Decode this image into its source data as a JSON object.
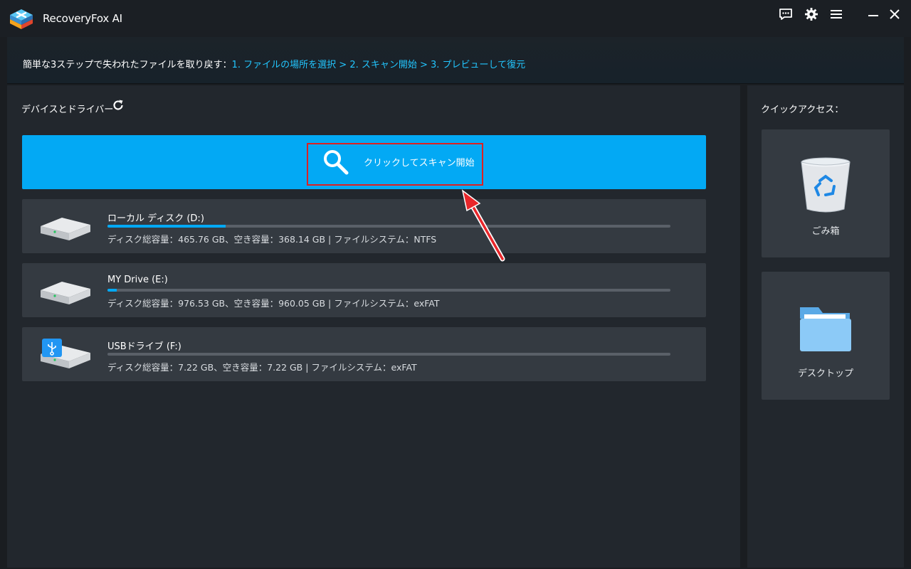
{
  "app": {
    "title": "RecoveryFox AI"
  },
  "steps": {
    "prefix": "簡単な3ステップで失われたファイルを取り戻す：",
    "links": "1. ファイルの場所を選択 > 2. スキャン開始 > 3. プレビューして復元"
  },
  "devices": {
    "title": "デバイスとドライバー",
    "scan_label": "クリックしてスキャン開始",
    "drives": [
      {
        "name": "ローカル ディスク (D:)",
        "info": "ディスク総容量：465.76 GB、空き容量：368.14 GB | ファイルシステム：NTFS",
        "used_fraction": 0.21,
        "type": "hdd"
      },
      {
        "name": "MY Drive (E:)",
        "info": "ディスク総容量：976.53 GB、空き容量：960.05 GB | ファイルシステム：exFAT",
        "used_fraction": 0.017,
        "type": "hdd"
      },
      {
        "name": "USBドライブ (F:)",
        "info": "ディスク総容量：7.22 GB、空き容量：7.22 GB | ファイルシステム：exFAT",
        "used_fraction": 0.0,
        "type": "usb"
      }
    ]
  },
  "quick_access": {
    "title": "クイックアクセス：",
    "items": [
      {
        "label": "ごみ箱",
        "icon": "recycle-bin-icon"
      },
      {
        "label": "デスクトップ",
        "icon": "folder-icon"
      }
    ]
  },
  "colors": {
    "accent": "#03a9f4",
    "highlight": "#e02020",
    "link": "#22c6ff"
  }
}
